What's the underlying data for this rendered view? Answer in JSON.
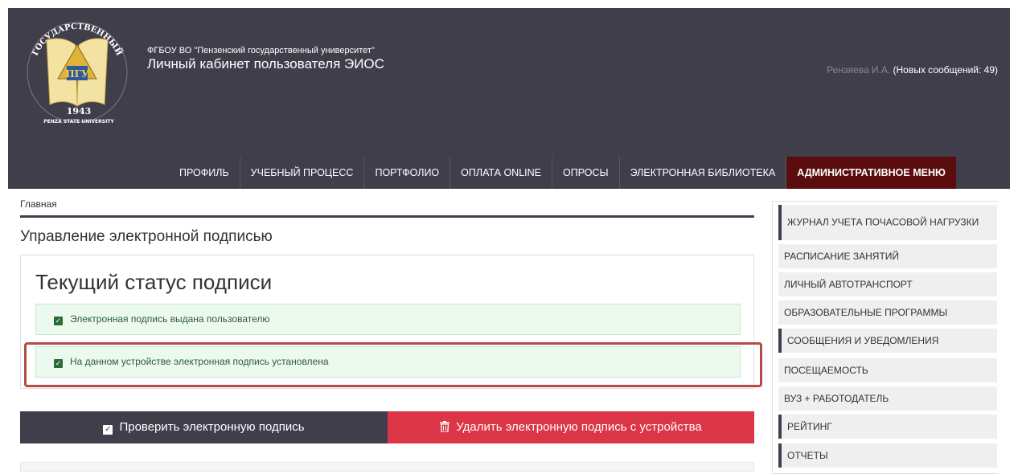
{
  "header": {
    "logo_text": "ГОСУДАРСТВЕННЫЙ ПЕНЗЕНСКИЙ УНИВЕРСИТЕТ ПГУ 1943 PENZA STATE UNIVERSITY",
    "university": "ФГБОУ ВО \"Пензенский государственный университет\"",
    "title": "Личный кабинет пользователя ЭИОС",
    "user": "Рензяева И.А.",
    "messages": "(Новых сообщений: 49)"
  },
  "nav": {
    "items": [
      "ПРОФИЛЬ",
      "УЧЕБНЫЙ ПРОЦЕСС",
      "ПОРТФОЛИО",
      "ОПЛАТА ONLINE",
      "ОПРОСЫ",
      "ЭЛЕКТРОННАЯ БИБЛИОТЕКА",
      "АДМИНИСТРАТИВНОЕ МЕНЮ"
    ]
  },
  "breadcrumb": "Главная",
  "page_title": "Управление электронной подписью",
  "status": {
    "heading": "Текущий статус подписи",
    "alerts": [
      "Электронная подпись выдана пользователю",
      "На данном устройстве электронная подпись установлена"
    ]
  },
  "buttons": {
    "verify": "Проверить электронную подпись",
    "delete": "Удалить электронную подпись с устройства"
  },
  "sidebar": {
    "items": [
      "ЖУРНАЛ УЧЕТА ПОЧАСОВОЙ НАГРУЗКИ",
      "РАСПИСАНИЕ ЗАНЯТИЙ",
      "ЛИЧНЫЙ АВТОТРАНСПОРТ",
      "ОБРАЗОВАТЕЛЬНЫЕ ПРОГРАММЫ",
      "СООБЩЕНИЯ И УВЕДОМЛЕНИЯ",
      "ПОСЕЩАЕМОСТЬ",
      "ВУЗ + РАБОТОДАТЕЛЬ",
      "РЕЙТИНГ",
      "ОТЧЕТЫ"
    ]
  },
  "colors": {
    "header_bg": "#413e4c",
    "admin_menu_bg": "#5b0c0c",
    "delete_button": "#dc3545",
    "alert_bg": "#ecf9ee",
    "highlight_border": "#b84a45"
  },
  "icons": {
    "verify": "check-square-icon",
    "delete": "trash-icon",
    "alert": "check-square-icon"
  }
}
